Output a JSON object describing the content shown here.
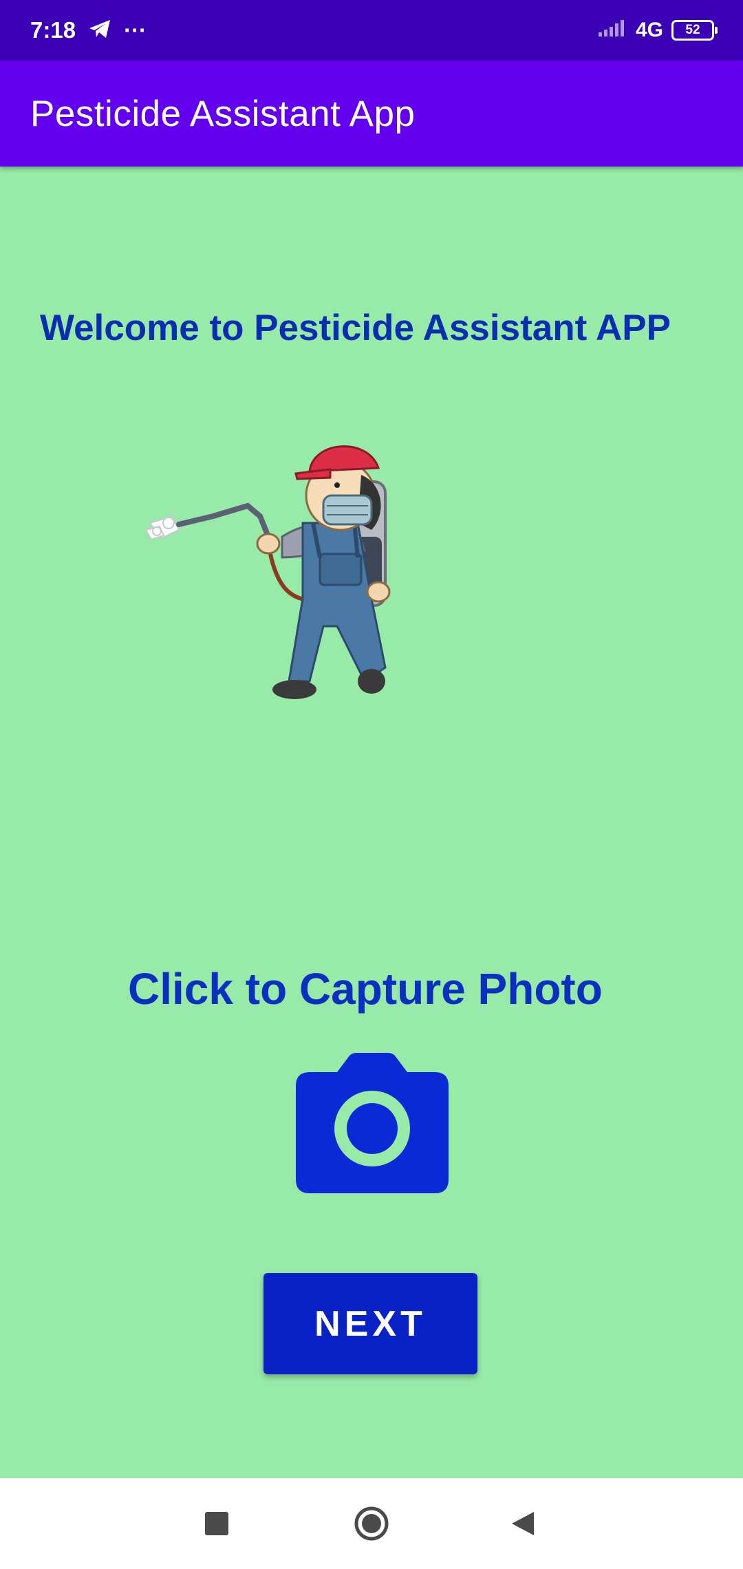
{
  "status_bar": {
    "time": "7:18",
    "more_indicator": "···",
    "network": "4G",
    "battery": "52",
    "icons": [
      "telegram-icon",
      "signal-icon",
      "battery-icon"
    ]
  },
  "app_bar": {
    "title": "Pesticide Assistant App"
  },
  "main": {
    "welcome_text": "Welcome to Pesticide Assistant APP",
    "illustration": "farmer-spraying-pesticide-illustration",
    "capture_label": "Click to Capture Photo",
    "camera_icon": "camera-icon",
    "next_label": "NEXT"
  },
  "nav_bar": {
    "items": [
      "recents-icon",
      "home-icon",
      "back-icon"
    ]
  },
  "colors": {
    "background": "#98eaa8",
    "status_bar": "#3b00b3",
    "app_bar": "#6200ee",
    "text_primary": "#0b2db0",
    "button": "#0822c6"
  }
}
